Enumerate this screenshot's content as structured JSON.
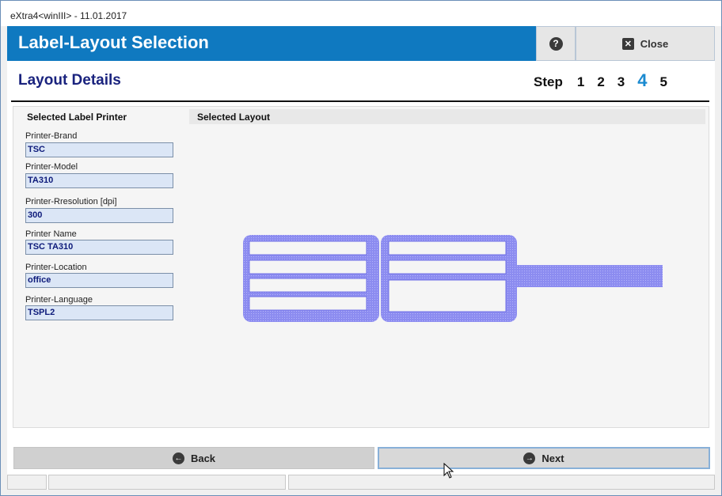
{
  "window": {
    "title": "eXtra4<winIII>  -  11.01.2017"
  },
  "banner": {
    "title": "Label-Layout Selection",
    "help_icon": "question-mark-icon",
    "help_glyph": "?",
    "close_icon": "close-x-icon",
    "close_glyph": "✕",
    "close_label": "Close"
  },
  "section": {
    "title": "Layout Details",
    "step_label": "Step",
    "steps": [
      "1",
      "2",
      "3",
      "4",
      "5"
    ],
    "current_step": "4"
  },
  "printer": {
    "heading": "Selected Label Printer",
    "fields": [
      {
        "label": "Printer-Brand",
        "value": "TSC"
      },
      {
        "label": "Printer-Model",
        "value": "TA310"
      },
      {
        "label": "Printer-Rresolution [dpi]",
        "value": "300"
      },
      {
        "label": "Printer Name",
        "value": "TSC TA310"
      },
      {
        "label": "Printer-Location",
        "value": "office"
      },
      {
        "label": "Printer-Language",
        "value": "TSPL2"
      }
    ]
  },
  "layout": {
    "heading": "Selected Layout"
  },
  "nav": {
    "back_label": "Back",
    "back_glyph": "←",
    "next_label": "Next",
    "next_glyph": "→"
  },
  "colors": {
    "banner": "#0f79c0",
    "title": "#1a237e",
    "current_step": "#1a8ad0",
    "field_bg": "#dbe6f6",
    "layout_preview": "#8c8cf0"
  }
}
